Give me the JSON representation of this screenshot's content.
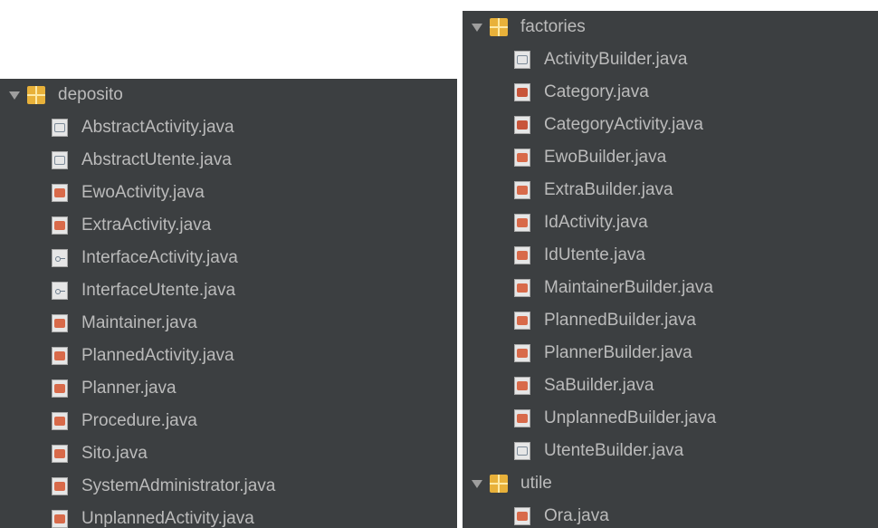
{
  "left_panel": {
    "package": "deposito",
    "files": [
      {
        "name": "AbstractActivity.java",
        "icon": "abstract"
      },
      {
        "name": "AbstractUtente.java",
        "icon": "abstract"
      },
      {
        "name": "EwoActivity.java",
        "icon": "class"
      },
      {
        "name": "ExtraActivity.java",
        "icon": "class"
      },
      {
        "name": "InterfaceActivity.java",
        "icon": "interface"
      },
      {
        "name": "InterfaceUtente.java",
        "icon": "interface"
      },
      {
        "name": "Maintainer.java",
        "icon": "class"
      },
      {
        "name": "PlannedActivity.java",
        "icon": "class"
      },
      {
        "name": "Planner.java",
        "icon": "class"
      },
      {
        "name": "Procedure.java",
        "icon": "class"
      },
      {
        "name": "Sito.java",
        "icon": "class"
      },
      {
        "name": "SystemAdministrator.java",
        "icon": "class"
      },
      {
        "name": "UnplannedActivity.java",
        "icon": "class"
      }
    ]
  },
  "right_panel": {
    "package": "factories",
    "files": [
      {
        "name": "ActivityBuilder.java",
        "icon": "abstract"
      },
      {
        "name": "Category.java",
        "icon": "enum"
      },
      {
        "name": "CategoryActivity.java",
        "icon": "enum"
      },
      {
        "name": "EwoBuilder.java",
        "icon": "class"
      },
      {
        "name": "ExtraBuilder.java",
        "icon": "class"
      },
      {
        "name": "IdActivity.java",
        "icon": "class"
      },
      {
        "name": "IdUtente.java",
        "icon": "class"
      },
      {
        "name": "MaintainerBuilder.java",
        "icon": "class"
      },
      {
        "name": "PlannedBuilder.java",
        "icon": "class"
      },
      {
        "name": "PlannerBuilder.java",
        "icon": "class"
      },
      {
        "name": "SaBuilder.java",
        "icon": "class"
      },
      {
        "name": "UnplannedBuilder.java",
        "icon": "class"
      },
      {
        "name": "UtenteBuilder.java",
        "icon": "abstract"
      }
    ],
    "package2": "utile",
    "files2": [
      {
        "name": "Ora.java",
        "icon": "class"
      }
    ]
  },
  "colors": {
    "panel_bg": "#3c3f41",
    "text": "#bbbbbb",
    "package_icon": "#e8b13a",
    "class_icon": "#d86a4a"
  }
}
